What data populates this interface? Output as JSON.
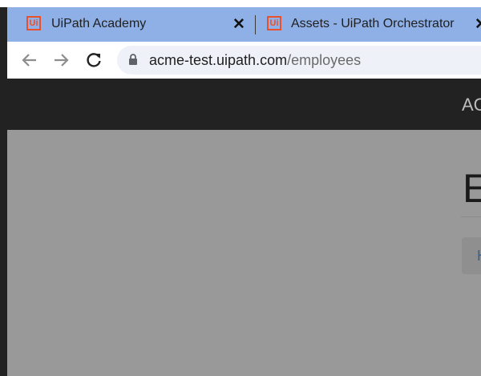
{
  "browser": {
    "tabs": [
      {
        "title": "UiPath Academy",
        "logo": "Ui",
        "active": false
      },
      {
        "title": "Assets - UiPath Orchestrator",
        "logo": "Ui",
        "active": false
      }
    ],
    "close_glyph": "✕",
    "nav": {
      "back_icon": "arrow-left-icon",
      "forward_icon": "arrow-right-icon",
      "reload_icon": "reload-icon"
    },
    "url_host": "acme-test.uipath.com",
    "url_path": "/employees"
  },
  "site": {
    "brand": "AC",
    "page_title": "E",
    "crumb_link": "H"
  },
  "colors": {
    "tab_bar": "#8fb0e6",
    "uipath_orange": "#e8512b",
    "site_header": "#222222",
    "content_bg": "#999999"
  }
}
